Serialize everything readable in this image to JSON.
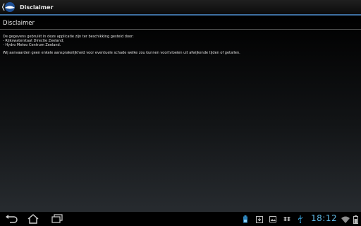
{
  "app_bar": {
    "title": "Disclaimer",
    "icon": "app-logo-icon"
  },
  "page": {
    "title": "Disclaimer",
    "paragraph1_line1": "De gegevens gebruikt in deze applicatie zijn ter beschikking gesteld door:",
    "paragraph1_line2": "- Rijkswaterstaat Directie Zeeland;",
    "paragraph1_line3": "- Hydro Meteo Centrum Zeeland.",
    "paragraph2": "Wij aanvaarden geen enkele aansprakelijkheid voor eventuele schade welke zou kunnen voortvloeien uit afwijkende tijden of getallen."
  },
  "nav": {
    "icons": [
      "back-icon",
      "home-icon",
      "recent-apps-icon"
    ]
  },
  "status": {
    "icons": [
      "battery-saver-icon",
      "download-icon",
      "gallery-icon",
      "dropbox-icon",
      "usb-icon"
    ],
    "time": "18:12",
    "wifi": "wifi-icon",
    "battery": "battery-icon"
  },
  "colors": {
    "accent": "#3d6fa0",
    "clock": "#5fb9e6"
  }
}
